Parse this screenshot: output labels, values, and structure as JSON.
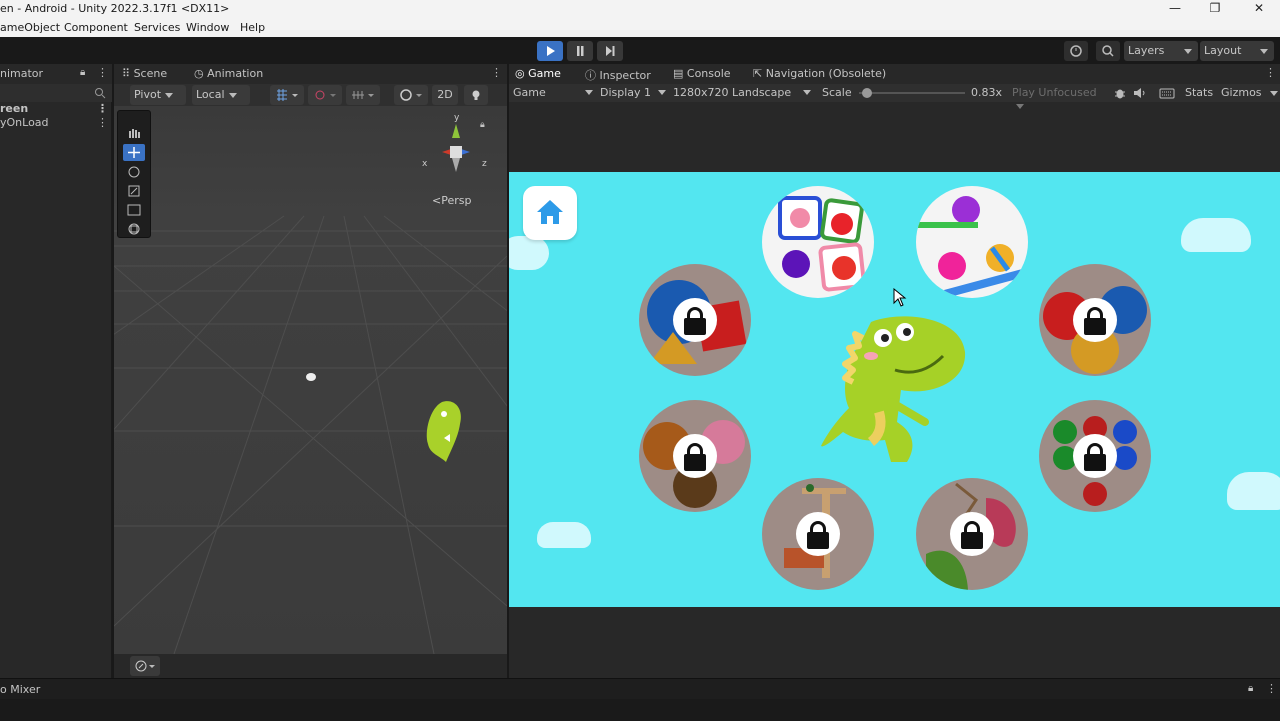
{
  "window": {
    "title": "en - Android - Unity 2022.3.17f1 <DX11>",
    "minimize": "—",
    "restore": "❐",
    "close": "✕"
  },
  "menu": [
    "ameObject",
    "Component",
    "Services",
    "Window",
    "Help"
  ],
  "toolbar": {
    "layers_label": "Layers",
    "layout_label": "Layout"
  },
  "hierarchy": {
    "tab_label": "nimator",
    "items": [
      "reen",
      "yOnLoad"
    ]
  },
  "scene_panel": {
    "tabs": [
      "Scene",
      "Animation"
    ],
    "pivot_label": "Pivot",
    "local_label": "Local",
    "mode_2d": "2D",
    "persp_label": "<Persp",
    "gizmo_axes": {
      "x": "x",
      "y": "y",
      "z": "z"
    }
  },
  "game_panel": {
    "tabs": [
      "Game",
      "Inspector",
      "Console",
      "Navigation (Obsolete)"
    ],
    "game_dropdown": "Game",
    "display_dropdown": "Display 1",
    "resolution_dropdown": "1280x720 Landscape",
    "scale_label": "Scale",
    "scale_value": "0.83x",
    "scale_fraction": 0.03,
    "play_focus_dropdown": "Play Unfocused",
    "stats_label": "Stats",
    "gizmos_label": "Gizmos"
  },
  "game_menu": {
    "background_color": "#53e6f0",
    "levels": [
      {
        "name": "cards-level",
        "locked": false
      },
      {
        "name": "balls-level",
        "locked": false
      },
      {
        "name": "shapes-level",
        "locked": true
      },
      {
        "name": "birds-level",
        "locked": true
      },
      {
        "name": "animals-level",
        "locked": true
      },
      {
        "name": "abacus-level",
        "locked": true
      },
      {
        "name": "blocks-level",
        "locked": true
      },
      {
        "name": "dino-puzzle-level",
        "locked": true
      }
    ]
  },
  "bottom": {
    "audio_mixer_tab": "o Mixer"
  }
}
